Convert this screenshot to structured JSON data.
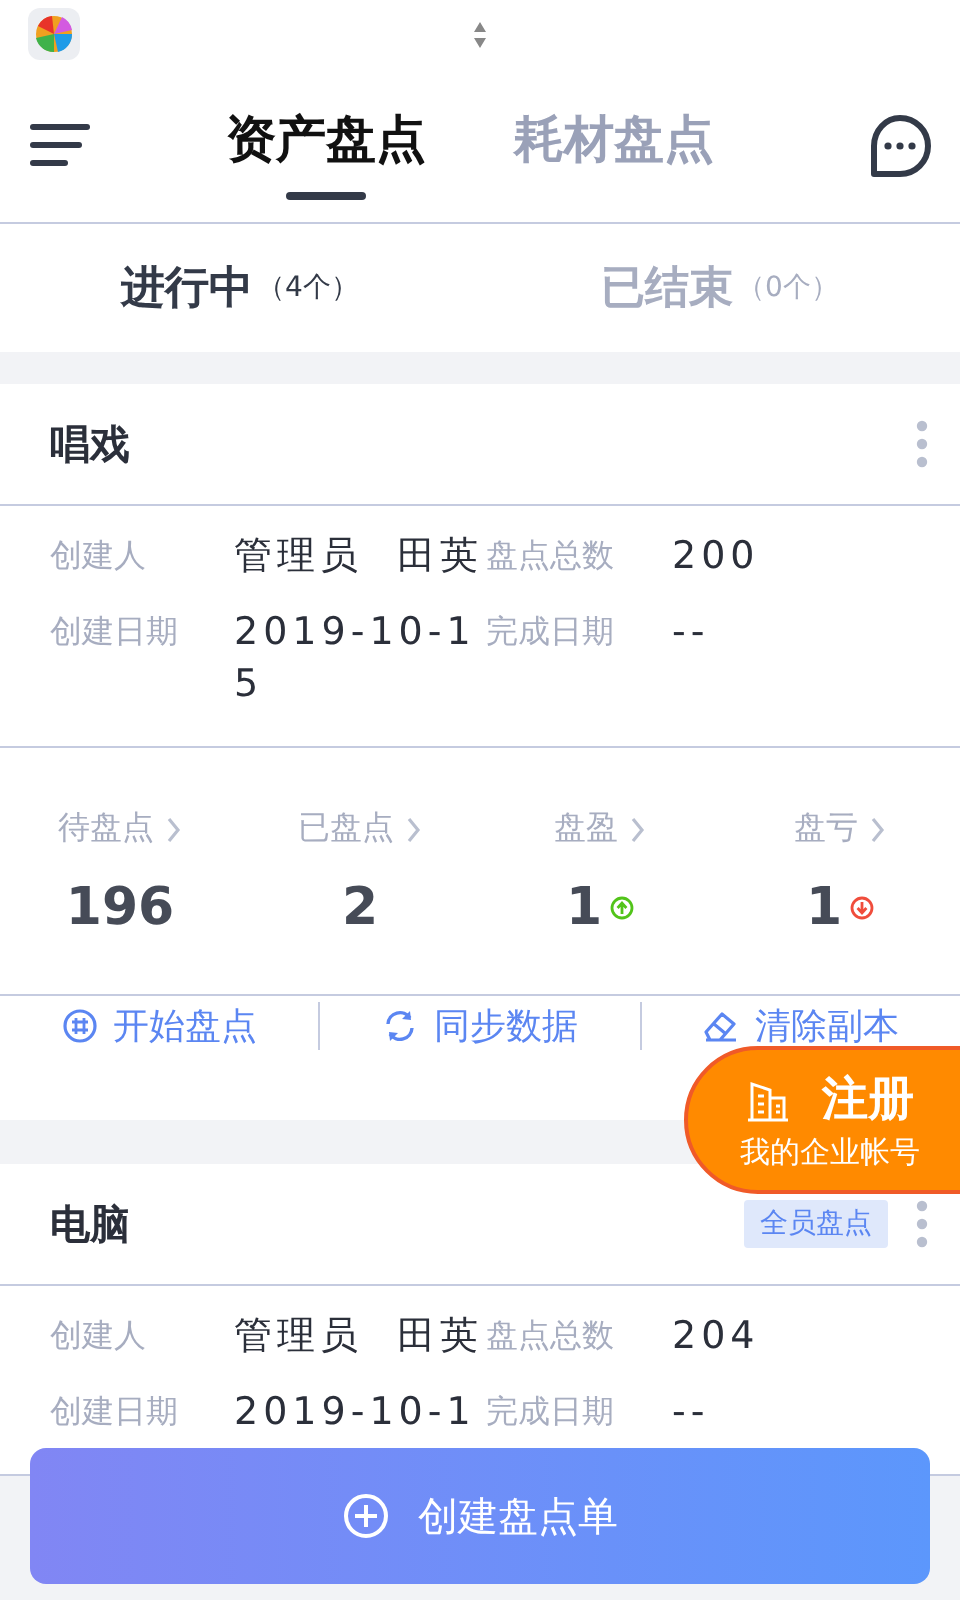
{
  "header": {
    "tabs": [
      {
        "label": "资产盘点",
        "selected": true
      },
      {
        "label": "耗材盘点",
        "selected": false
      }
    ]
  },
  "filters": [
    {
      "label": "进行中",
      "count": "（4个）",
      "selected": true
    },
    {
      "label": "已结束",
      "count": "（0个）",
      "selected": false
    }
  ],
  "cards": [
    {
      "title": "唱戏",
      "fields": [
        {
          "label": "创建人",
          "value": "管理员  田英"
        },
        {
          "label": "盘点总数",
          "value": "200"
        },
        {
          "label": "创建日期",
          "value": "2019-10-15"
        },
        {
          "label": "完成日期",
          "value": "--"
        }
      ],
      "stats": [
        {
          "label": "待盘点",
          "value": "196",
          "kind": "plain"
        },
        {
          "label": "已盘点",
          "value": "2",
          "kind": "plain"
        },
        {
          "label": "盘盈",
          "value": "1",
          "kind": "gain"
        },
        {
          "label": "盘亏",
          "value": "1",
          "kind": "loss"
        }
      ],
      "actions": [
        {
          "label": "开始盘点",
          "kind": "start"
        },
        {
          "label": "同步数据",
          "kind": "sync"
        },
        {
          "label": "清除副本",
          "kind": "erase"
        }
      ]
    },
    {
      "title": "电脑",
      "tag": "全员盘点",
      "fields": [
        {
          "label": "创建人",
          "value": "管理员  田英"
        },
        {
          "label": "盘点总数",
          "value": "204"
        },
        {
          "label": "创建日期",
          "value": "2019-10-1"
        },
        {
          "label": "完成日期",
          "value": "--"
        }
      ]
    }
  ],
  "promo": {
    "title": "注册",
    "subtitle": "我的企业帐号"
  },
  "create_button": {
    "label": "创建盘点单"
  }
}
